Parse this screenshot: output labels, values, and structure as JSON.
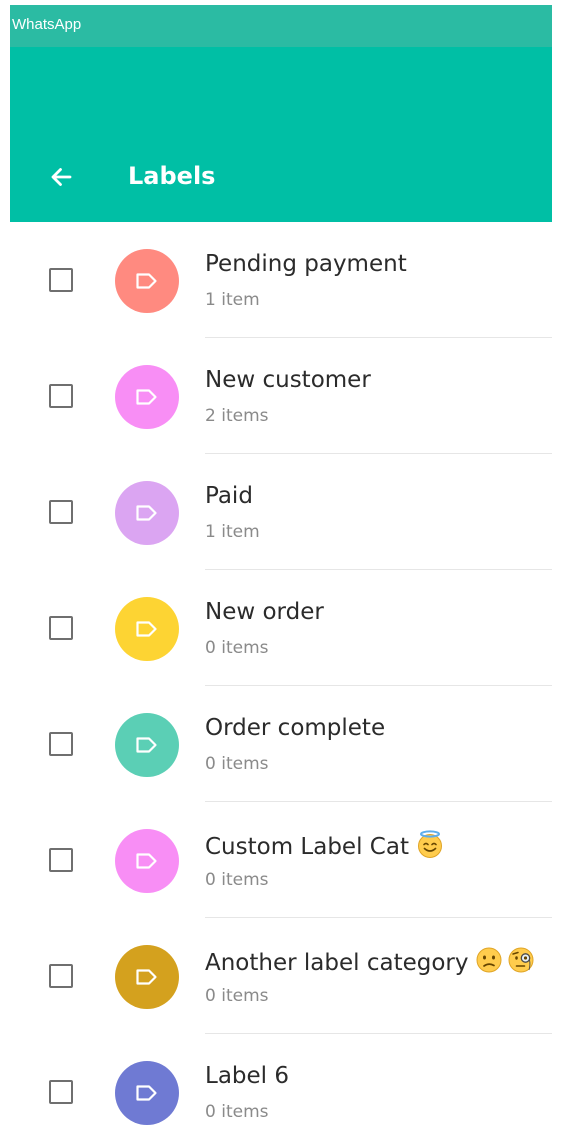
{
  "window": {
    "title": "WhatsApp"
  },
  "appbar": {
    "back_icon": "arrow-left-icon",
    "title": "Labels"
  },
  "colors": {
    "titlebar": "#2bbba3",
    "appbar": "#00bfa5"
  },
  "labels": [
    {
      "name": "Pending payment",
      "count": "1 item",
      "color": "#ff8a80",
      "emojis": []
    },
    {
      "name": "New customer",
      "count": "2 items",
      "color": "#f88ef5",
      "emojis": []
    },
    {
      "name": "Paid",
      "count": "1 item",
      "color": "#dba5f2",
      "emojis": []
    },
    {
      "name": "New order",
      "count": "0 items",
      "color": "#fdd433",
      "emojis": []
    },
    {
      "name": "Order complete",
      "count": "0 items",
      "color": "#5bcfb5",
      "emojis": []
    },
    {
      "name": "Custom Label Cat",
      "count": "0 items",
      "color": "#f88ef5",
      "emojis": [
        "smiling-face-with-halo-emoji"
      ]
    },
    {
      "name": "Another label category",
      "count": "0 items",
      "color": "#d4a11e",
      "emojis": [
        "confused-face-emoji",
        "face-with-monocle-emoji"
      ]
    },
    {
      "name": "Label 6",
      "count": "0 items",
      "color": "#6f7ad3",
      "emojis": []
    }
  ]
}
